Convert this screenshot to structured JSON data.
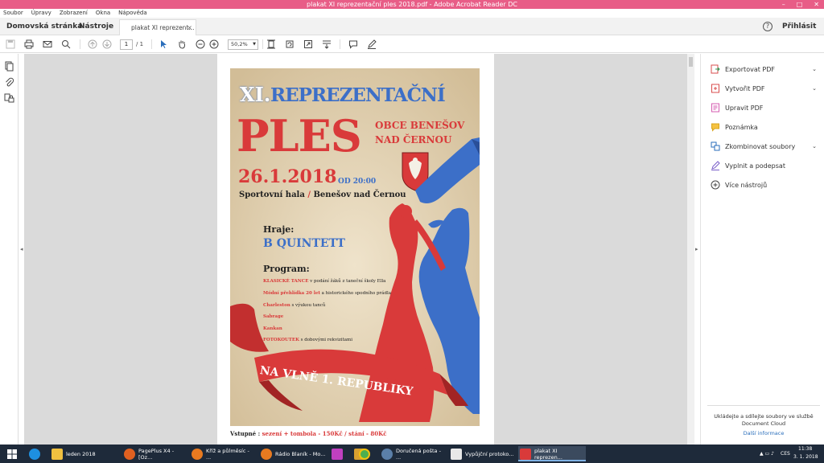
{
  "window": {
    "title": "plakat XI reprezentační ples 2018.pdf - Adobe Acrobat Reader DC"
  },
  "menu": [
    "Soubor",
    "Úpravy",
    "Zobrazení",
    "Okna",
    "Nápověda"
  ],
  "tabs": {
    "home": "Domovská stránka",
    "tools": "Nástroje",
    "doc": "plakat XI reprezent...",
    "doc_close": "×",
    "help": "?",
    "signin": "Přihlásit se"
  },
  "toolbar": {
    "page_current": "1",
    "page_total": "/ 1",
    "zoom": "50,2%"
  },
  "poster": {
    "numeral": "XI.",
    "title_line1": "REPREZENTAČNÍ",
    "title_big": "PLES",
    "town_line1": "OBCE BENEŠOV",
    "town_line2": "NAD ČERNOU",
    "date": "26.1.2018",
    "time": "OD 20:00",
    "venue_a": "Sportovní hala",
    "venue_sep": " / ",
    "venue_b": "Benešov nad Černou",
    "band_label": "Hraje:",
    "band": "B QUINTETT",
    "program_label": "Program:",
    "program": [
      {
        "hl": "KLASICKÉ TANCE",
        "rest": " v podání žáků z taneční školy Ella"
      },
      {
        "hl": "Módní přehlídka 20 let",
        "rest": " a historického spodního prádla"
      },
      {
        "hl": "Charleston",
        "rest": " s výukou tanců"
      },
      {
        "hl": "Sabrage",
        "rest": ""
      },
      {
        "hl": "Kankan",
        "rest": ""
      },
      {
        "hl": "FOTOKOUTEK",
        "rest": " s dobovými rekvizitami"
      }
    ],
    "ribbon": "NA VLNĚ 1. REPUBLIKY",
    "entry_label": "Vstupné :",
    "entry_value": " sezení + tombola - 150Kč / stání - 80Kč"
  },
  "right_panel": {
    "tools": [
      "Exportovat PDF",
      "Vytvořit PDF",
      "Upravit PDF",
      "Poznámka",
      "Zkombinovat soubory",
      "Vyplnit a podepsat",
      "Více nástrojů"
    ],
    "cloud_message": "Ukládejte a sdílejte soubory ve službě Document Cloud",
    "cloud_link": "Další informace"
  },
  "taskbar": {
    "items": [
      "leden 2018",
      "PagePlus X4 - [Oz...",
      "Kříž a půlměsíc - ...",
      "Rádio Blaník - Mo...",
      "Doručená pošta - ...",
      "Vypůjční protoko...",
      "plakat XI reprezen..."
    ],
    "tray_line1": "CES",
    "time": "11:38",
    "date": "3. 1. 2018"
  },
  "colors": {
    "accent": "#e85d87",
    "poster_red": "#d93a3a",
    "poster_blue": "#3c6fc8"
  }
}
